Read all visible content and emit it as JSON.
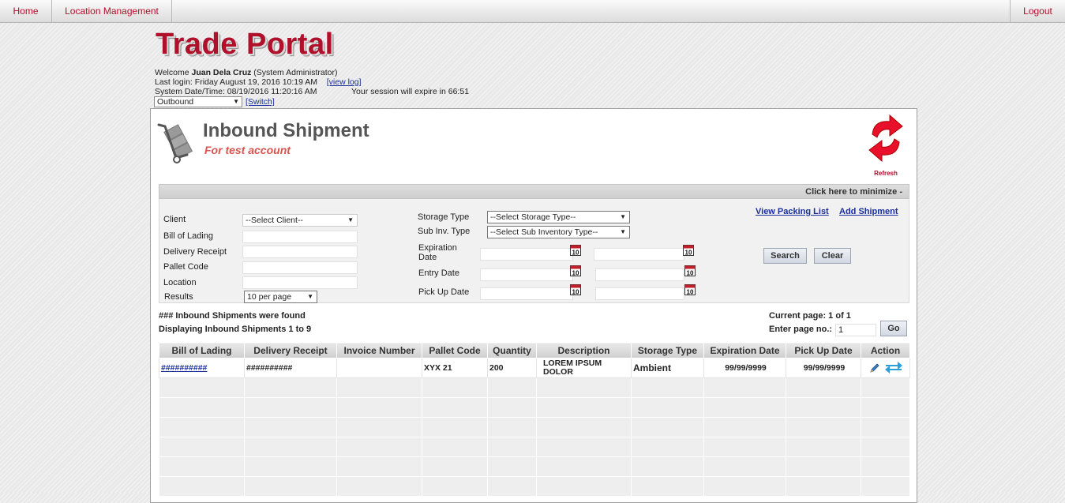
{
  "nav": {
    "home": "Home",
    "location_management": "Location Management",
    "logout": "Logout"
  },
  "brand": "Trade Portal",
  "user": {
    "welcome_prefix": "Welcome",
    "name": "Juan Dela Cruz",
    "role": "(System Administrator)",
    "last_login": "Last login: Friday August 19, 2016 10:19 AM",
    "view_log": "[view log]",
    "system_datetime": "System Date/Time: 08/19/2016 11:20:16 AM",
    "session": "Your session will expire in 66:51",
    "mode": "Outbound",
    "switch": "[Switch]"
  },
  "page": {
    "title": "Inbound Shipment",
    "subtitle": "For test account",
    "refresh": "Refresh"
  },
  "filter": {
    "minimize": "Click here to minimize  -",
    "client_label": "Client",
    "client_value": "--Select Client--",
    "bol_label": "Bill of Lading",
    "dr_label": "Delivery Receipt",
    "pallet_label": "Pallet Code",
    "location_label": "Location",
    "results_label": "Results",
    "results_value": "10 per page",
    "storage_label": "Storage Type",
    "storage_value": "--Select Storage Type--",
    "subinv_label": "Sub Inv. Type",
    "subinv_value": "--Select Sub Inventory Type--",
    "expiration_label_1": "Expiration",
    "expiration_label_2": "Date",
    "entry_label": "Entry Date",
    "pickup_label": "Pick Up Date",
    "view_packing": "View Packing List",
    "add_shipment": "Add Shipment",
    "search": "Search",
    "clear": "Clear",
    "cal_day": "10"
  },
  "results": {
    "found": "### Inbound Shipments were found",
    "displaying": "Displaying Inbound Shipments 1 to 9",
    "current_page": "Current page: 1 of 1",
    "enter_page": "Enter page no.:",
    "page_value": "1",
    "go": "Go"
  },
  "table": {
    "headers": [
      "Bill of Lading",
      "Delivery Receipt",
      "Invoice Number",
      "Pallet Code",
      "Quantity",
      "Description",
      "Storage Type",
      "Expiration Date",
      "Pick Up Date",
      "Action"
    ],
    "row": {
      "bol": "##########",
      "dr": "##########",
      "invoice": "",
      "pallet": "XYX 21",
      "quantity": "200",
      "description_1": "LOREM IPSUM",
      "description_2": "DOLOR",
      "storage": "Ambient",
      "expiration": "99/99/9999",
      "pickup": "99/99/9999"
    }
  },
  "icons": {
    "cart": "hand-truck-icon",
    "refresh": "refresh-icon",
    "calendar": "calendar-icon",
    "edit": "pencil-icon",
    "transfer": "transfer-arrows-icon"
  },
  "colors": {
    "brand": "#b0102a",
    "subtitle": "#d9534f",
    "link": "#1a2f9c"
  }
}
